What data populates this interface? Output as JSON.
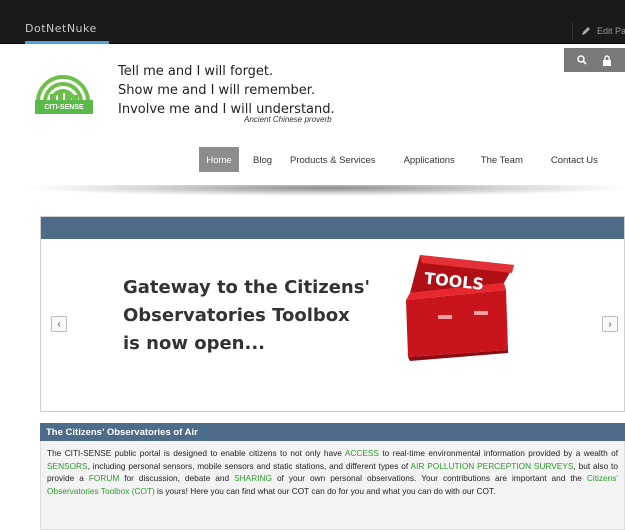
{
  "topbar": {
    "brand": "DotNetNuke",
    "edit_label": "Edit Pag"
  },
  "logo": {
    "badge": "CITI-SENSE"
  },
  "quote": {
    "line1": "Tell me and I will forget.",
    "line2": "Show me and I will remember.",
    "line3": "Involve me and I will understand.",
    "source": "Ancient Chinese proverb"
  },
  "nav": {
    "items": [
      {
        "label": "Home"
      },
      {
        "label": "Blog"
      },
      {
        "label": "Products & Services"
      },
      {
        "label": "Applications"
      },
      {
        "label": "The Team"
      },
      {
        "label": "Contact Us"
      }
    ]
  },
  "slider": {
    "line1": "Gateway to the Citizens'",
    "line2": "Observatories Toolbox",
    "line3": "is now open...",
    "toolbox_label": "TOOLS",
    "prev": "‹",
    "next": "›"
  },
  "section": {
    "title": "The Citizens' Observatories of Air",
    "p1": "The CITI-SENSE public portal is designed to enable citizens to not only have ",
    "access": "ACCESS",
    "p2": " to real-time environmental information provided by a wealth of ",
    "sensors": "SENSORS",
    "p3": ", including personal sensors, mobile sensors and static stations, and different types of ",
    "surveys": "AIR POLLUTION PERCEPTION SURVEYS",
    "p4": ", but also to provide a ",
    "forum": "FORUM",
    "p5": " for discussion, debate and ",
    "sharing": "SHARING",
    "p6": " of your own personal observations. Your contributions are important and the ",
    "cot": "Citizens' Observatories Toolbox (COT)",
    "p7": " is yours! Here you can find what our COT can do for you and what you can do with our COT."
  },
  "colors": {
    "accent": "#4d6c8a",
    "highlight": "#2e9a2e",
    "brand_green": "#5bb84a"
  }
}
